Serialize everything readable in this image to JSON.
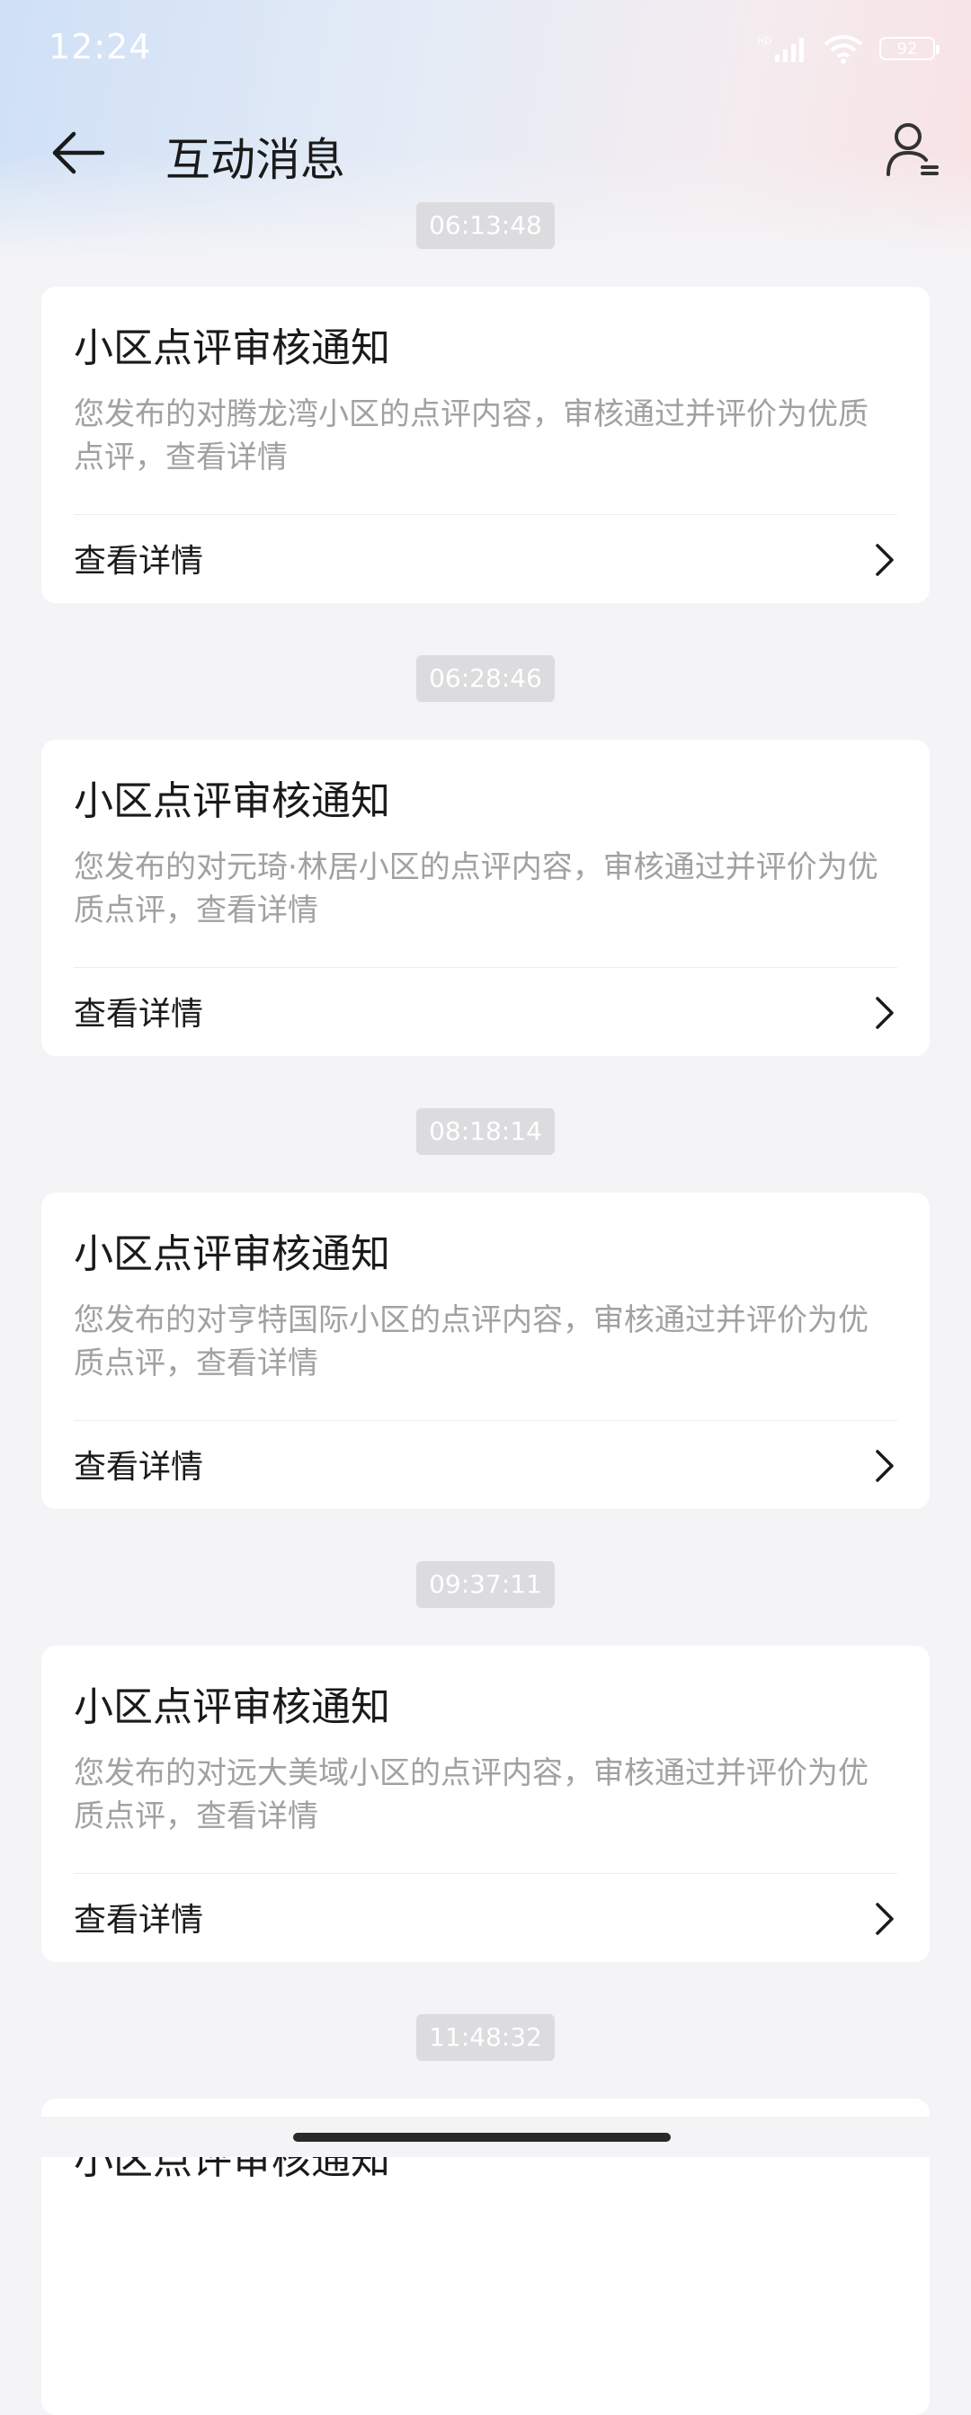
{
  "status_bar": {
    "time": "12:24",
    "battery": "92",
    "icons": [
      "hd-signal-icon",
      "wifi-icon",
      "battery-icon"
    ]
  },
  "header": {
    "title": "互动消息",
    "back_icon": "arrow-left-icon",
    "user_icon": "user-settings-icon"
  },
  "messages": [
    {
      "time": "06:13:48",
      "title": "小区点评审核通知",
      "body": "您发布的对腾龙湾小区的点评内容，审核通过并评价为优质点评，查看详情",
      "action": "查看详情"
    },
    {
      "time": "06:28:46",
      "title": "小区点评审核通知",
      "body": "您发布的对元琦·林居小区的点评内容，审核通过并评价为优质点评，查看详情",
      "action": "查看详情"
    },
    {
      "time": "08:18:14",
      "title": "小区点评审核通知",
      "body": "您发布的对亨特国际小区的点评内容，审核通过并评价为优质点评，查看详情",
      "action": "查看详情"
    },
    {
      "time": "09:37:11",
      "title": "小区点评审核通知",
      "body": "您发布的对远大美域小区的点评内容，审核通过并评价为优质点评，查看详情",
      "action": "查看详情"
    },
    {
      "time": "11:48:32",
      "title": "小区点评审核通知",
      "body": "",
      "action": ""
    }
  ],
  "colors": {
    "background": "#f4f4f6",
    "card": "#ffffff",
    "timestamp_bg": "#dcdcdf",
    "body_text": "#a1a1a4"
  }
}
